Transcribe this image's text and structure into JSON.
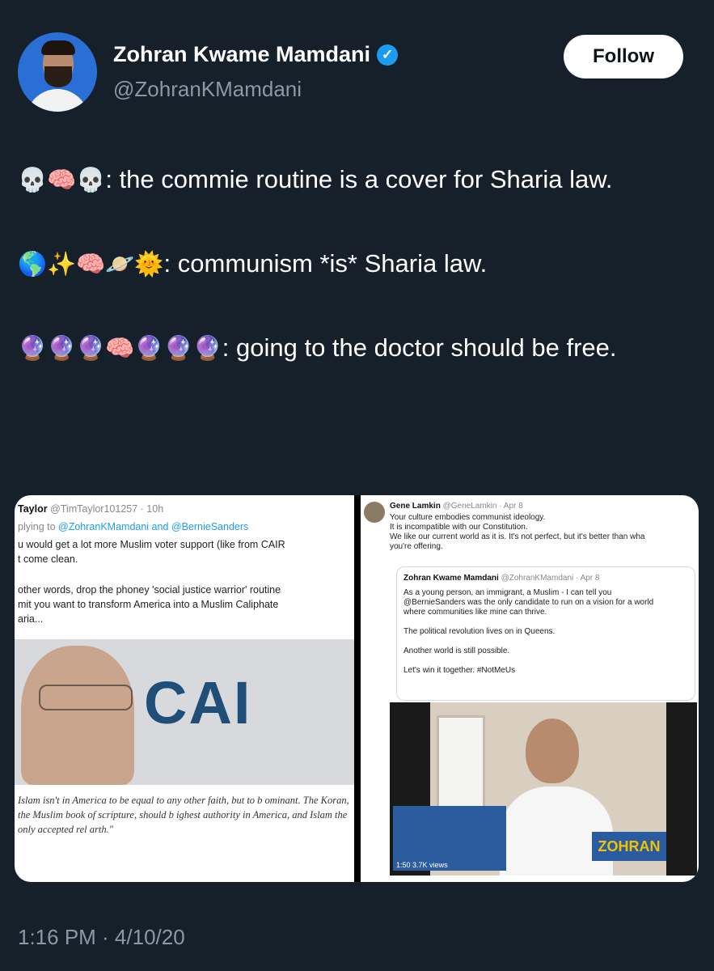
{
  "author": {
    "name": "Zohran Kwame Mamdani",
    "handle": "@ZohranKMamdani",
    "verified_icon": "verified-badge-icon",
    "follow_label": "Follow"
  },
  "tweet": {
    "paragraphs": [
      {
        "emoji": "💀🧠💀",
        "text": ": the commie routine is a cover for Sharia law."
      },
      {
        "emoji": "🌎✨🧠🪐🌞",
        "text": ": communism *is* Sharia law."
      },
      {
        "emoji": "🔮🔮🔮🧠🔮🔮🔮",
        "text": ": going to the doctor should be free."
      }
    ],
    "timestamp": "1:16 PM · 4/10/20"
  },
  "media_left": {
    "author": "Taylor",
    "handle": "@TimTaylor101257 · 10h",
    "replying_prefix": "plying to ",
    "replying_to": "@ZohranKMamdani and @BernieSanders",
    "line1": "u would get a lot more Muslim voter support (like from CAIR",
    "line2": "t come clean.",
    "line3": "other words, drop the phoney 'social justice warrior' routine",
    "line4": "mit you want to transform America into a Muslim Caliphate",
    "line5": "aria...",
    "image_logo": "CAI",
    "quote": "Islam isn't in America to be equal to any other faith, but to b ominant. The Koran, the Muslim book of scripture, should b ighest authority in America, and Islam the only accepted rel arth.\""
  },
  "media_right": {
    "author": "Gene Lamkin",
    "handle": "@GeneLamkin · Apr 8",
    "line1": "Your culture embodies communist ideology.",
    "line2": "It is incompatible with our Constitution.",
    "line3": "We like our current world as it is. It's not perfect, but it's better than wha",
    "line4": "you're offering.",
    "quoted_author": "Zohran Kwame Mamdani",
    "quoted_handle": "@ZohranKMamdani · Apr 8",
    "q1": "As a young person, an immigrant, a Muslim - I can tell you",
    "q2": "@BernieSanders was the only candidate to run on a vision for a world",
    "q3": "where communities like mine can thrive.",
    "q4": "The political revolution lives on in Queens.",
    "q5": "Another world is still possible.",
    "q6": "Let's win it together. #NotMeUs",
    "video_time": "1:50",
    "video_views": "3.7K views",
    "poster": "ZOHRAN"
  }
}
